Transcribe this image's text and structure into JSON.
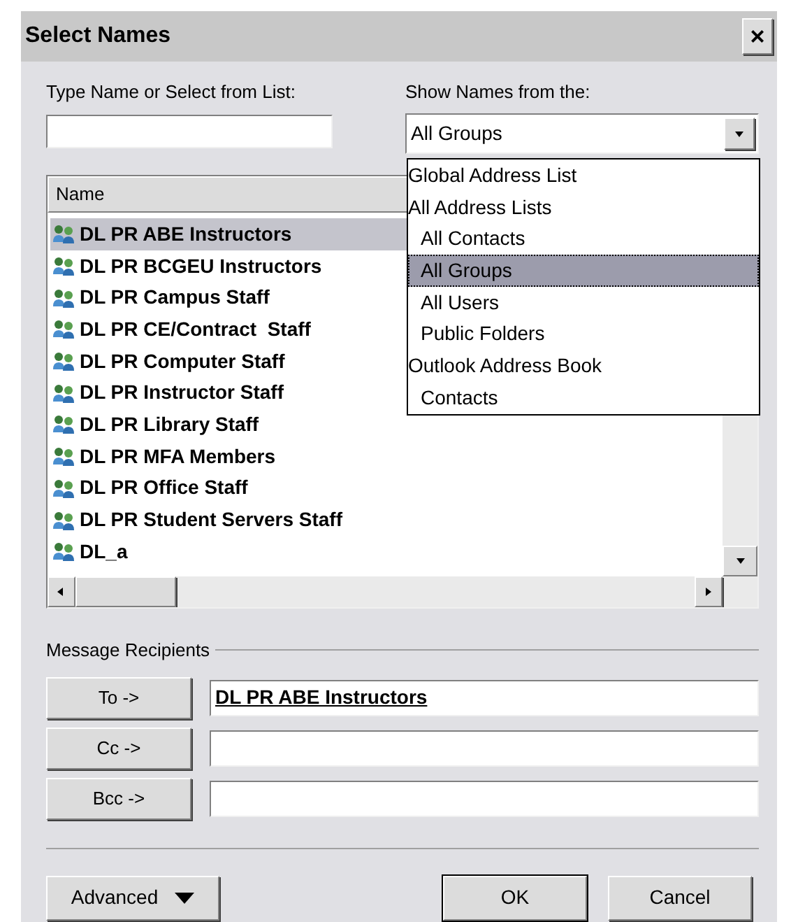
{
  "window": {
    "title": "Select Names",
    "close": "×"
  },
  "search": {
    "label": "Type Name or Select from List:"
  },
  "source": {
    "label": "Show Names from the:",
    "value": "All Groups",
    "expanded": true,
    "options": [
      {
        "label": "Global Address List",
        "selected": false
      },
      {
        "label": "All Address Lists",
        "selected": false,
        "children": [
          {
            "label": "All Contacts",
            "selected": false
          },
          {
            "label": "All Groups",
            "selected": true
          },
          {
            "label": "All Users",
            "selected": false
          },
          {
            "label": "Public Folders",
            "selected": false
          }
        ]
      },
      {
        "label": "Outlook Address Book",
        "selected": false,
        "children": [
          {
            "label": "Contacts",
            "selected": false
          }
        ]
      }
    ]
  },
  "list": {
    "columns": [
      "Name"
    ],
    "rows": [
      {
        "name": "DL PR ABE Instructors",
        "selected": true
      },
      {
        "name": "DL PR BCGEU Instructors",
        "selected": false
      },
      {
        "name": "DL PR Campus Staff",
        "selected": false
      },
      {
        "name": "DL PR CE/Contract  Staff",
        "selected": false
      },
      {
        "name": "DL PR Computer Staff",
        "selected": false
      },
      {
        "name": "DL PR Instructor Staff",
        "selected": false
      },
      {
        "name": "DL PR Library Staff",
        "selected": false
      },
      {
        "name": "DL PR MFA Members",
        "selected": false
      },
      {
        "name": "DL PR Office Staff",
        "selected": false
      },
      {
        "name": "DL PR Student Servers Staff",
        "selected": false
      },
      {
        "name": "DL_a",
        "selected": false
      }
    ]
  },
  "recipients": {
    "title": "Message Recipients",
    "rows": [
      {
        "button": "To ->",
        "value": "DL PR ABE Instructors"
      },
      {
        "button": "Cc ->"
      },
      {
        "button": "Bcc ->"
      }
    ]
  },
  "buttons": {
    "advanced": "Advanced",
    "ok": "OK",
    "cancel": "Cancel"
  }
}
